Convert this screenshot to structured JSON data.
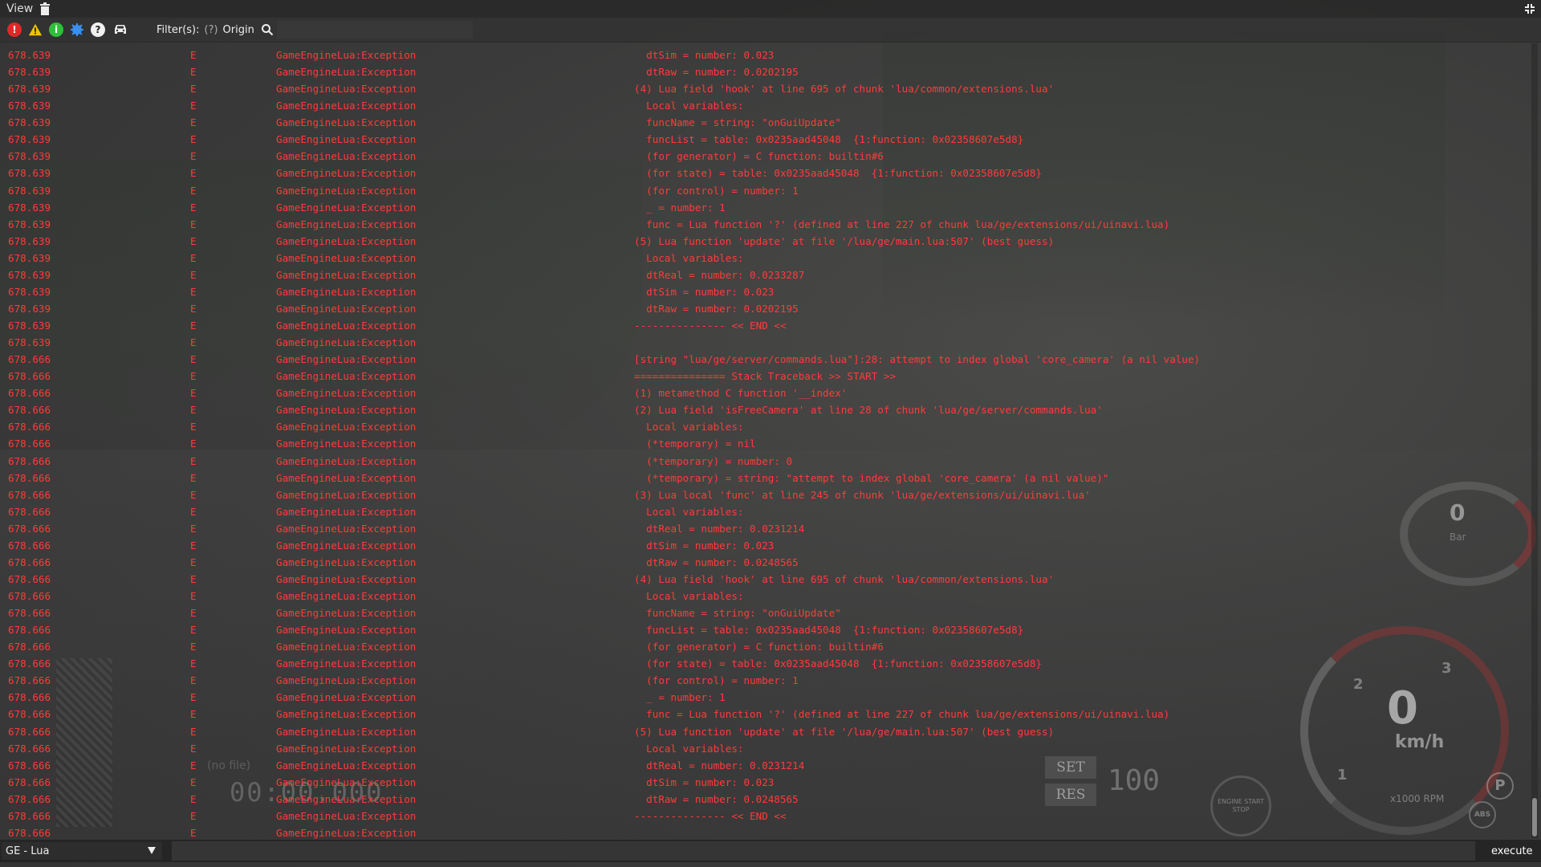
{
  "menubar": {
    "view_label": "View"
  },
  "toolbar": {
    "filter_label": "Filter(s):",
    "filter_help": "(?)",
    "origin_label": "Origin",
    "filter_value": "",
    "icons": [
      "error-icon",
      "warning-icon",
      "info-icon",
      "debug-icon",
      "help-icon",
      "car-icon"
    ]
  },
  "colors": {
    "log_error": "#ff3b3b",
    "error_icon": "#e02828",
    "warning_icon": "#f2c200",
    "info_icon": "#2fbf3a",
    "debug_icon": "#3a8ff0"
  },
  "log": {
    "rows": [
      {
        "time": "678.639",
        "level": "E",
        "origin": "GameEngineLua:Exception",
        "msg": "  dtSim = number: 0.023"
      },
      {
        "time": "678.639",
        "level": "E",
        "origin": "GameEngineLua:Exception",
        "msg": "  dtRaw = number: 0.0202195"
      },
      {
        "time": "678.639",
        "level": "E",
        "origin": "GameEngineLua:Exception",
        "msg": "(4) Lua field 'hook' at line 695 of chunk 'lua/common/extensions.lua'"
      },
      {
        "time": "678.639",
        "level": "E",
        "origin": "GameEngineLua:Exception",
        "msg": "  Local variables:"
      },
      {
        "time": "678.639",
        "level": "E",
        "origin": "GameEngineLua:Exception",
        "msg": "  funcName = string: \"onGuiUpdate\""
      },
      {
        "time": "678.639",
        "level": "E",
        "origin": "GameEngineLua:Exception",
        "msg": "  funcList = table: 0x0235aad45048  {1:function: 0x02358607e5d8}"
      },
      {
        "time": "678.639",
        "level": "E",
        "origin": "GameEngineLua:Exception",
        "msg": "  (for generator) = C function: builtin#6"
      },
      {
        "time": "678.639",
        "level": "E",
        "origin": "GameEngineLua:Exception",
        "msg": "  (for state) = table: 0x0235aad45048  {1:function: 0x02358607e5d8}"
      },
      {
        "time": "678.639",
        "level": "E",
        "origin": "GameEngineLua:Exception",
        "msg": "  (for control) = number: 1"
      },
      {
        "time": "678.639",
        "level": "E",
        "origin": "GameEngineLua:Exception",
        "msg": "  _ = number: 1"
      },
      {
        "time": "678.639",
        "level": "E",
        "origin": "GameEngineLua:Exception",
        "msg": "  func = Lua function '?' (defined at line 227 of chunk lua/ge/extensions/ui/uinavi.lua)"
      },
      {
        "time": "678.639",
        "level": "E",
        "origin": "GameEngineLua:Exception",
        "msg": "(5) Lua function 'update' at file '/lua/ge/main.lua:507' (best guess)"
      },
      {
        "time": "678.639",
        "level": "E",
        "origin": "GameEngineLua:Exception",
        "msg": "  Local variables:"
      },
      {
        "time": "678.639",
        "level": "E",
        "origin": "GameEngineLua:Exception",
        "msg": "  dtReal = number: 0.0233287"
      },
      {
        "time": "678.639",
        "level": "E",
        "origin": "GameEngineLua:Exception",
        "msg": "  dtSim = number: 0.023"
      },
      {
        "time": "678.639",
        "level": "E",
        "origin": "GameEngineLua:Exception",
        "msg": "  dtRaw = number: 0.0202195"
      },
      {
        "time": "678.639",
        "level": "E",
        "origin": "GameEngineLua:Exception",
        "msg": "--------------- << END <<"
      },
      {
        "time": "678.639",
        "level": "E",
        "origin": "GameEngineLua:Exception",
        "msg": ""
      },
      {
        "time": "678.666",
        "level": "E",
        "origin": "GameEngineLua:Exception",
        "msg": "[string \"lua/ge/server/commands.lua\"]:28: attempt to index global 'core_camera' (a nil value)"
      },
      {
        "time": "678.666",
        "level": "E",
        "origin": "GameEngineLua:Exception",
        "msg": "=============== Stack Traceback >> START >>"
      },
      {
        "time": "678.666",
        "level": "E",
        "origin": "GameEngineLua:Exception",
        "msg": "(1) metamethod C function '__index'"
      },
      {
        "time": "678.666",
        "level": "E",
        "origin": "GameEngineLua:Exception",
        "msg": "(2) Lua field 'isFreeCamera' at line 28 of chunk 'lua/ge/server/commands.lua'"
      },
      {
        "time": "678.666",
        "level": "E",
        "origin": "GameEngineLua:Exception",
        "msg": "  Local variables:"
      },
      {
        "time": "678.666",
        "level": "E",
        "origin": "GameEngineLua:Exception",
        "msg": "  (*temporary) = nil"
      },
      {
        "time": "678.666",
        "level": "E",
        "origin": "GameEngineLua:Exception",
        "msg": "  (*temporary) = number: 0"
      },
      {
        "time": "678.666",
        "level": "E",
        "origin": "GameEngineLua:Exception",
        "msg": "  (*temporary) = string: \"attempt to index global 'core_camera' (a nil value)\""
      },
      {
        "time": "678.666",
        "level": "E",
        "origin": "GameEngineLua:Exception",
        "msg": "(3) Lua local 'func' at line 245 of chunk 'lua/ge/extensions/ui/uinavi.lua'"
      },
      {
        "time": "678.666",
        "level": "E",
        "origin": "GameEngineLua:Exception",
        "msg": "  Local variables:"
      },
      {
        "time": "678.666",
        "level": "E",
        "origin": "GameEngineLua:Exception",
        "msg": "  dtReal = number: 0.0231214"
      },
      {
        "time": "678.666",
        "level": "E",
        "origin": "GameEngineLua:Exception",
        "msg": "  dtSim = number: 0.023"
      },
      {
        "time": "678.666",
        "level": "E",
        "origin": "GameEngineLua:Exception",
        "msg": "  dtRaw = number: 0.0248565"
      },
      {
        "time": "678.666",
        "level": "E",
        "origin": "GameEngineLua:Exception",
        "msg": "(4) Lua field 'hook' at line 695 of chunk 'lua/common/extensions.lua'"
      },
      {
        "time": "678.666",
        "level": "E",
        "origin": "GameEngineLua:Exception",
        "msg": "  Local variables:"
      },
      {
        "time": "678.666",
        "level": "E",
        "origin": "GameEngineLua:Exception",
        "msg": "  funcName = string: \"onGuiUpdate\""
      },
      {
        "time": "678.666",
        "level": "E",
        "origin": "GameEngineLua:Exception",
        "msg": "  funcList = table: 0x0235aad45048  {1:function: 0x02358607e5d8}"
      },
      {
        "time": "678.666",
        "level": "E",
        "origin": "GameEngineLua:Exception",
        "msg": "  (for generator) = C function: builtin#6"
      },
      {
        "time": "678.666",
        "level": "E",
        "origin": "GameEngineLua:Exception",
        "msg": "  (for state) = table: 0x0235aad45048  {1:function: 0x02358607e5d8}"
      },
      {
        "time": "678.666",
        "level": "E",
        "origin": "GameEngineLua:Exception",
        "msg": "  (for control) = number: 1"
      },
      {
        "time": "678.666",
        "level": "E",
        "origin": "GameEngineLua:Exception",
        "msg": "  _ = number: 1"
      },
      {
        "time": "678.666",
        "level": "E",
        "origin": "GameEngineLua:Exception",
        "msg": "  func = Lua function '?' (defined at line 227 of chunk lua/ge/extensions/ui/uinavi.lua)"
      },
      {
        "time": "678.666",
        "level": "E",
        "origin": "GameEngineLua:Exception",
        "msg": "(5) Lua function 'update' at file '/lua/ge/main.lua:507' (best guess)"
      },
      {
        "time": "678.666",
        "level": "E",
        "origin": "GameEngineLua:Exception",
        "msg": "  Local variables:"
      },
      {
        "time": "678.666",
        "level": "E",
        "origin": "GameEngineLua:Exception",
        "msg": "  dtReal = number: 0.0231214"
      },
      {
        "time": "678.666",
        "level": "E",
        "origin": "GameEngineLua:Exception",
        "msg": "  dtSim = number: 0.023"
      },
      {
        "time": "678.666",
        "level": "E",
        "origin": "GameEngineLua:Exception",
        "msg": "  dtRaw = number: 0.0248565"
      },
      {
        "time": "678.666",
        "level": "E",
        "origin": "GameEngineLua:Exception",
        "msg": "--------------- << END <<"
      },
      {
        "time": "678.666",
        "level": "E",
        "origin": "GameEngineLua:Exception",
        "msg": ""
      }
    ]
  },
  "bottombar": {
    "lang_select": "GE - Lua",
    "command_value": "",
    "execute_label": "execute"
  },
  "hud": {
    "speed": "0",
    "speed_unit": "km/h",
    "rpm_label": "x1000 RPM",
    "gear_1": "1",
    "gear_2": "2",
    "gear_3": "3",
    "boost_value": "0",
    "boost_unit": "Bar",
    "cruise_set": "SET",
    "cruise_res": "RES",
    "cruise_value": "100",
    "engine_label": "ENGINE START STOP",
    "timer": "00:00.000",
    "no_file": "(no file)",
    "parking": "P",
    "abs": "ABS"
  }
}
